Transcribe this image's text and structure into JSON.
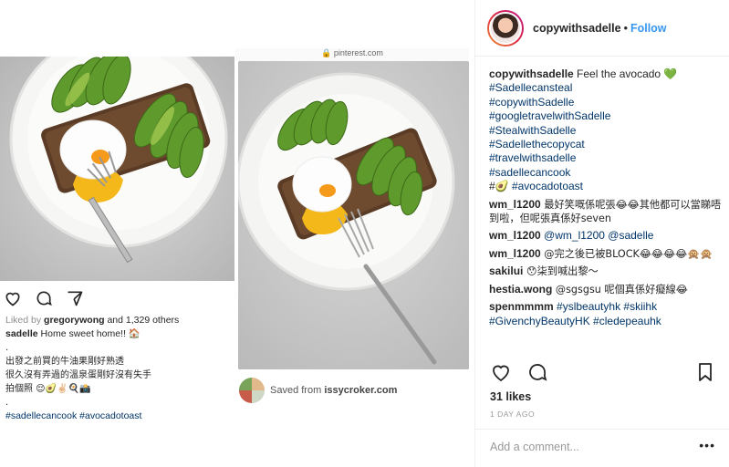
{
  "left_post": {
    "likes_prefix": "Liked by ",
    "likes_user": "gregorywong",
    "likes_suffix": " and 1,329 others",
    "caption_user": "sadelle",
    "caption_text": " Home sweet home!! 🏠",
    "line1": ".",
    "line2": "出發之前買的牛油果剛好熟透",
    "line3": "很久沒有弄過的溫泉蛋剛好沒有失手",
    "line4": "拍個照 😌🥑✌🏻🍳📸",
    "line5": ".",
    "hashtags": "#sadellecancook #avocadotoast"
  },
  "pinterest": {
    "url": "🔒 pinterest.com",
    "saved_prefix": "Saved from ",
    "saved_source": "issycroker.com"
  },
  "sidebar": {
    "username": "copywithsadelle",
    "dot": "•",
    "follow_label": "Follow",
    "caption_user": "copywithsadelle",
    "caption_text": " Feel the avocado 💚",
    "hashtags": [
      "#Sadellecansteal",
      "#copywithSadelle",
      "#googletravelwithSadelle",
      "#StealwithSadelle",
      "#Sadellethecopycat",
      "#travelwithsadelle",
      "#sadellecancook"
    ],
    "last_tag_prefix": "#🥑 ",
    "last_tag": "#avocadotoast",
    "comments": [
      {
        "user": "wm_l1200",
        "text": " 最好笑嘅係呢張😂😂其他都可以當睇唔到啦，但呢張真係好seven"
      },
      {
        "user": "wm_l1200",
        "text": " @wm_l1200 @sadelle"
      },
      {
        "user": "wm_l1200",
        "text": " @完之後已被BLOCK😂😂😂😂🙊🙊"
      },
      {
        "user": "sakilui",
        "text": " 😯柒到喊出黎～"
      },
      {
        "user": "hestia.wong",
        "text": " @sgsgsu 呢個真係好癡線😂"
      },
      {
        "user": "spenmmmm",
        "text": " #yslbeautyhk #skiihk #GivenchyBeautyHK #cledepeauhk"
      }
    ],
    "likes": "31 likes",
    "time": "1 DAY AGO",
    "comment_placeholder": "Add a comment...",
    "more": "•••"
  },
  "colors": {
    "follow_blue": "#3897f0",
    "hashtag_blue": "#003569",
    "avocado_green": "#6aa52b",
    "yolk": "#f5b81b"
  }
}
